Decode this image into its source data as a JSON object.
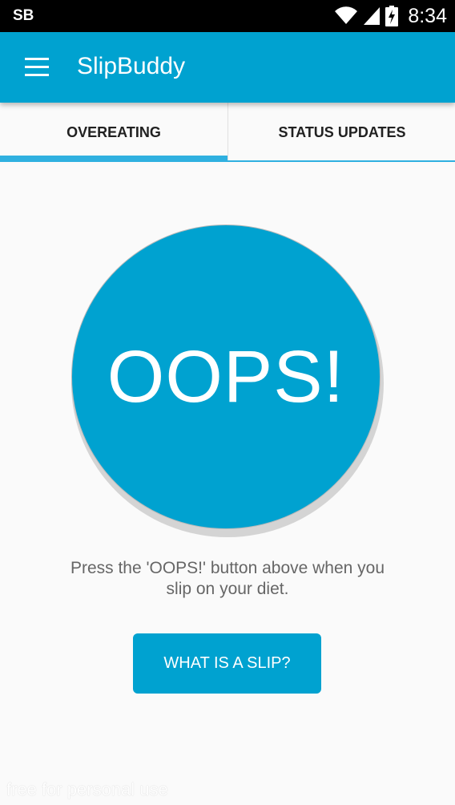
{
  "status_bar": {
    "carrier": "SB",
    "time": "8:34",
    "icons": [
      "wifi-icon",
      "signal-icon",
      "battery-charging-icon"
    ]
  },
  "app_bar": {
    "title": "SlipBuddy",
    "menu_icon": "hamburger-menu-icon"
  },
  "tabs": [
    {
      "label": "OVEREATING",
      "active": true
    },
    {
      "label": "STATUS UPDATES",
      "active": false
    }
  ],
  "main": {
    "oops_label": "OOPS!",
    "instruction": "Press the 'OOPS!' button above when you slip on your diet.",
    "slip_button_label": "WHAT IS A SLIP?"
  },
  "watermark": "free for personal use",
  "colors": {
    "primary": "#00a2d0",
    "tab_indicator": "#2fb0e0",
    "background": "#fafafa",
    "text_secondary": "#666666"
  }
}
